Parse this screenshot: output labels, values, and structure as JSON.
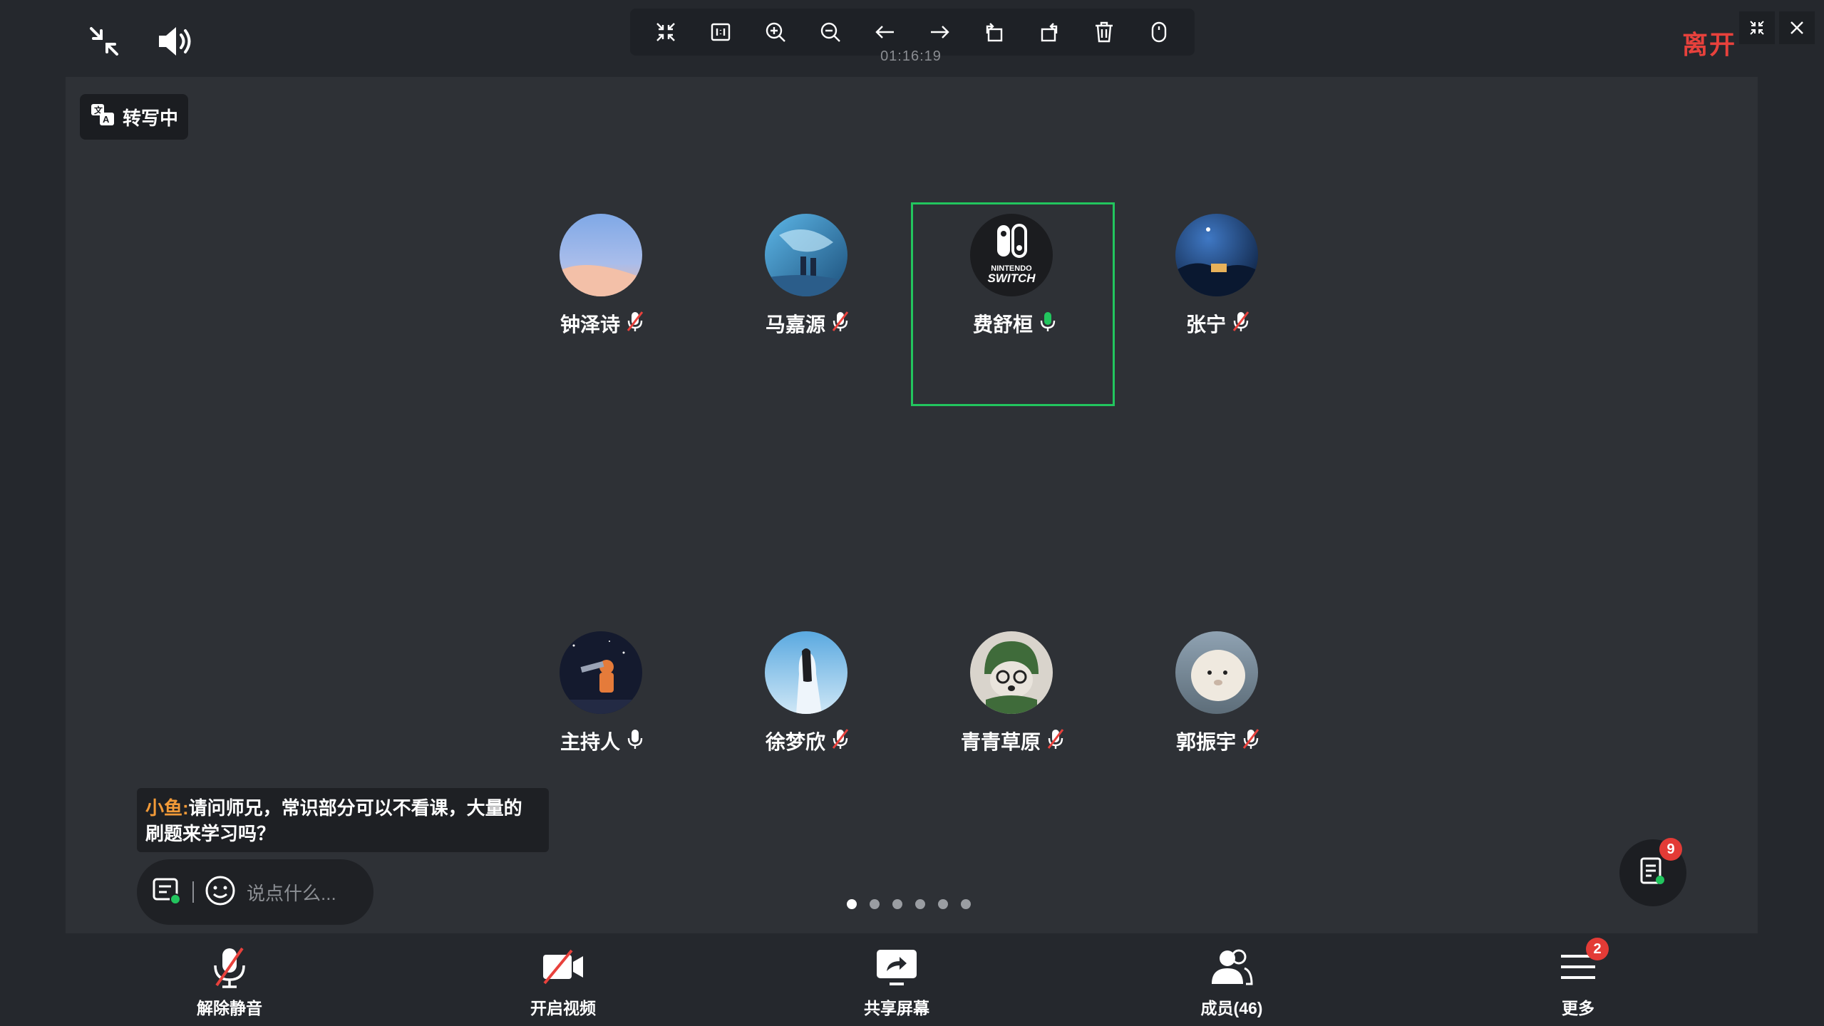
{
  "header": {
    "timer": "01:16:19",
    "leave_label": "离开"
  },
  "toolbar": {
    "buttons": [
      "fit-screen",
      "actual-size",
      "zoom-in",
      "zoom-out",
      "previous",
      "next",
      "rotate-left",
      "rotate-right",
      "delete",
      "mouse"
    ]
  },
  "transcribe": {
    "label": "转写中"
  },
  "participants": [
    {
      "name": "钟泽诗",
      "mic": "muted"
    },
    {
      "name": "马嘉源",
      "mic": "muted"
    },
    {
      "name": "费舒桓",
      "mic": "speaking",
      "active": true
    },
    {
      "name": "张宁",
      "mic": "muted"
    },
    {
      "name": "主持人",
      "mic": "on"
    },
    {
      "name": "徐梦欣",
      "mic": "muted"
    },
    {
      "name": "青青草原",
      "mic": "muted"
    },
    {
      "name": "郭振宇",
      "mic": "muted"
    }
  ],
  "avatar_logo_text": "NINTENDO SWITCH",
  "chat": {
    "sender": "小鱼:",
    "message": "请问师兄，常识部分可以不看课，大量的刷题来学习吗？",
    "placeholder": "说点什么..."
  },
  "pagination": {
    "pages": 6,
    "current": 1
  },
  "notes_badge": "9",
  "bottom": {
    "unmute": "解除静音",
    "start_video": "开启视频",
    "share_screen": "共享屏幕",
    "members": "成员(46)",
    "more": "更多",
    "more_badge": "2"
  },
  "colors": {
    "accent_green": "#22c55e",
    "leave_red": "#e8413c",
    "mute_red": "#e8413c",
    "sender_orange": "#f29a38",
    "badge_red": "#e33b36"
  }
}
